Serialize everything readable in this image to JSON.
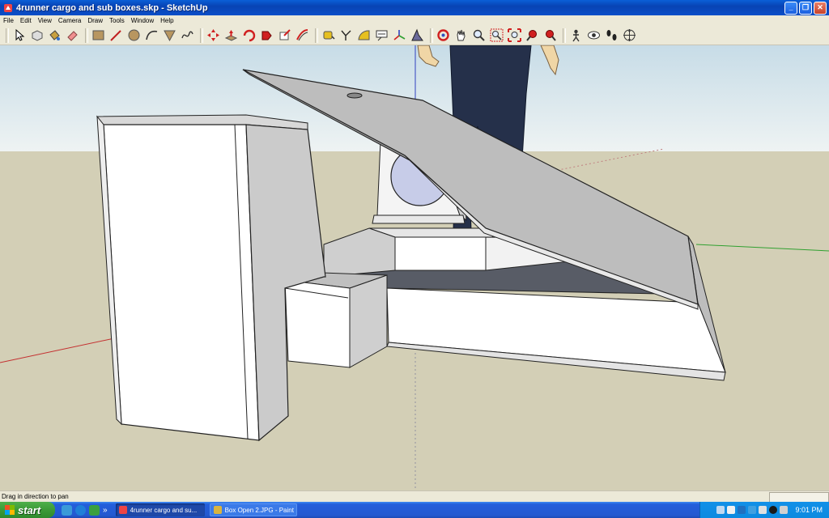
{
  "window": {
    "title": "4runner cargo and sub boxes.skp - SketchUp",
    "minimize": "_",
    "maximize": "❐",
    "close": "✕"
  },
  "menu": [
    "File",
    "Edit",
    "View",
    "Camera",
    "Draw",
    "Tools",
    "Window",
    "Help"
  ],
  "toolbar": {
    "tools": [
      "select-icon",
      "eraser-like-icon",
      "paint-bucket-icon",
      "eraser-icon",
      "rectangle-icon",
      "line-icon",
      "circle-icon",
      "arc-icon",
      "polygon-icon",
      "freehand-icon",
      "move-icon",
      "push-pull-icon",
      "rotate-icon",
      "follow-me-icon",
      "scale-icon",
      "offset-icon",
      "tape-measure-icon",
      "dimension-icon",
      "protractor-icon",
      "text-icon",
      "axes-icon",
      "3d-text-icon",
      "orbit-icon",
      "pan-icon",
      "zoom-icon",
      "zoom-window-icon",
      "zoom-extents-icon",
      "previous-view-icon",
      "position-camera-icon",
      "look-around-icon",
      "walk-icon",
      "section-plane-icon"
    ]
  },
  "status": {
    "message": "Drag in direction to pan"
  },
  "taskbar": {
    "start_label": "start",
    "overflow": "»",
    "tasks": [
      {
        "label": "4runner cargo and su...",
        "active": true
      },
      {
        "label": "Box Open 2.JPG - Paint",
        "active": false
      }
    ],
    "clock": "9:01 PM"
  },
  "colors": {
    "sky": "#dbe8ee",
    "ground": "#d3cfb6",
    "box_face": "#ffffff",
    "box_side": "#c9c9c9",
    "lid": "#bdbdbd",
    "carpet": "#585c66",
    "axis_red": "#c43030",
    "axis_green": "#30a030",
    "axis_blue": "#3040c0"
  }
}
